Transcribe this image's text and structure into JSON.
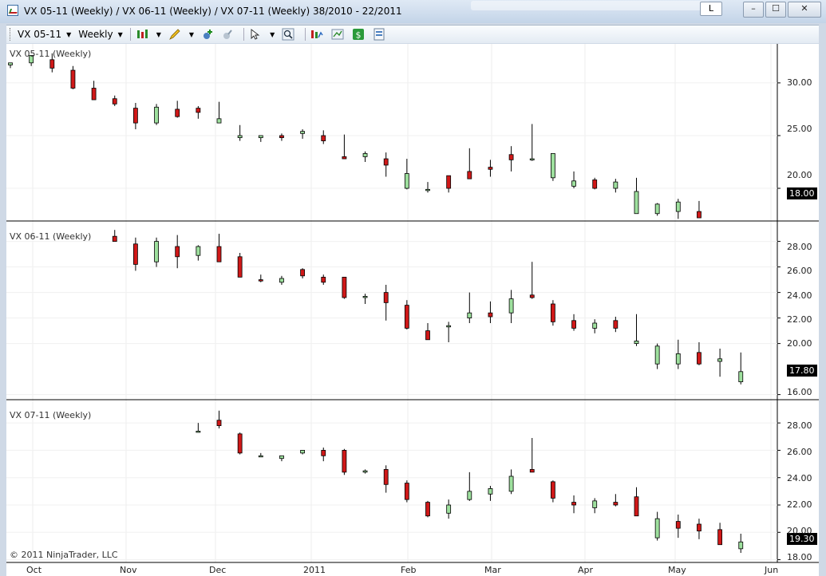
{
  "window": {
    "title": "VX 05-11 (Weekly) / VX 06-11 (Weekly) / VX 07-11 (Weekly)  38/2010 - 22/2011",
    "link_button": "L",
    "minimize": "–",
    "maximize": "☐",
    "close": "✕"
  },
  "toolbar": {
    "instrument": "VX 05-11",
    "interval": "Weekly"
  },
  "chart": {
    "copyright": "© 2011 NinjaTrader, LLC",
    "x_axis_labels": [
      "Oct",
      "Nov",
      "Dec",
      "2011",
      "Feb",
      "Mar",
      "Apr",
      "May",
      "Jun"
    ],
    "panels": [
      {
        "name": "VX 05-11 (Weekly)",
        "last_price": "18.00",
        "ticks": [
          "30.00",
          "25.00",
          "20.00"
        ]
      },
      {
        "name": "VX 06-11 (Weekly)",
        "last_price": "17.80",
        "ticks": [
          "28.00",
          "26.00",
          "24.00",
          "22.00",
          "20.00",
          "16.00"
        ]
      },
      {
        "name": "VX 07-11 (Weekly)",
        "last_price": "19.30",
        "ticks": [
          "28.00",
          "26.00",
          "24.00",
          "22.00",
          "20.00",
          "18.00"
        ]
      }
    ]
  },
  "colors": {
    "up": "#9ee09e",
    "down": "#d01818",
    "wick": "#000000",
    "background": "#ffffff"
  },
  "chart_data": {
    "type": "candlestick",
    "x": [
      "2010-09-27",
      "2010-10-04",
      "2010-10-11",
      "2010-10-18",
      "2010-10-25",
      "2010-11-01",
      "2010-11-08",
      "2010-11-15",
      "2010-11-22",
      "2010-11-29",
      "2010-12-06",
      "2010-12-13",
      "2010-12-20",
      "2010-12-27",
      "2011-01-03",
      "2011-01-10",
      "2011-01-17",
      "2011-01-24",
      "2011-01-31",
      "2011-02-07",
      "2011-02-14",
      "2011-02-21",
      "2011-02-28",
      "2011-03-07",
      "2011-03-14",
      "2011-03-21",
      "2011-03-28",
      "2011-04-04",
      "2011-04-11",
      "2011-04-18",
      "2011-04-25",
      "2011-05-02",
      "2011-05-09",
      "2011-05-16",
      "2011-05-23",
      "2011-05-30"
    ],
    "series": [
      {
        "name": "VX 05-11 (Weekly)",
        "open": [
          31.7,
          31.9,
          32.2,
          31.2,
          29.5,
          28.5,
          27.6,
          26.2,
          27.5,
          27.6,
          26.2,
          24.8,
          24.8,
          25.0,
          25.2,
          25.0,
          23.0,
          23.0,
          22.8,
          20.0,
          19.8,
          21.2,
          21.6,
          22.0,
          23.2,
          22.8,
          21.0,
          20.2,
          20.8,
          20.0,
          17.6,
          17.6,
          17.8,
          17.8,
          null,
          null
        ],
        "high": [
          31.9,
          32.6,
          32.8,
          31.6,
          30.2,
          28.8,
          28.1,
          28.0,
          28.3,
          27.8,
          28.2,
          26.0,
          25.0,
          25.2,
          25.6,
          25.5,
          25.1,
          23.5,
          23.4,
          22.8,
          20.6,
          21.2,
          23.8,
          22.7,
          24.0,
          26.1,
          23.0,
          21.6,
          21.0,
          20.9,
          21.0,
          18.6,
          19.0,
          18.8,
          19.2,
          null
        ],
        "low": [
          31.4,
          31.6,
          31.0,
          29.4,
          28.4,
          27.8,
          25.6,
          26.0,
          26.7,
          26.6,
          26.4,
          24.5,
          24.4,
          24.5,
          24.7,
          24.2,
          22.9,
          22.5,
          21.1,
          19.9,
          19.6,
          19.6,
          21.0,
          21.1,
          21.6,
          22.6,
          20.7,
          20.0,
          19.9,
          19.6,
          17.6,
          17.4,
          17.1,
          17.3,
          17.4,
          null
        ],
        "close": [
          31.9,
          32.6,
          31.4,
          29.5,
          28.4,
          28.0,
          26.2,
          27.7,
          26.8,
          27.2,
          26.6,
          25.0,
          25.0,
          24.8,
          25.4,
          24.5,
          22.8,
          23.3,
          22.2,
          21.4,
          19.9,
          20.0,
          20.9,
          21.8,
          22.7,
          22.8,
          23.3,
          20.7,
          20.0,
          20.6,
          19.7,
          18.5,
          18.7,
          17.2,
          18.0,
          null
        ]
      },
      {
        "name": "VX 06-11 (Weekly)",
        "open": [
          null,
          null,
          null,
          null,
          null,
          28.4,
          27.8,
          26.4,
          27.6,
          26.9,
          27.6,
          26.8,
          25.0,
          24.8,
          25.8,
          25.2,
          25.2,
          23.6,
          24.0,
          23.0,
          21.0,
          21.3,
          22.0,
          22.4,
          22.4,
          23.8,
          23.1,
          21.8,
          21.2,
          21.8,
          20.0,
          18.4,
          18.4,
          19.3,
          18.6,
          17.0
        ],
        "high": [
          null,
          null,
          null,
          null,
          null,
          28.9,
          28.3,
          28.3,
          28.5,
          27.7,
          28.6,
          27.1,
          25.4,
          25.3,
          25.9,
          25.4,
          25.2,
          23.9,
          24.6,
          23.4,
          21.6,
          21.7,
          24.0,
          23.3,
          24.2,
          26.4,
          23.4,
          22.3,
          21.9,
          22.1,
          22.3,
          20.0,
          20.3,
          20.1,
          19.6,
          19.3
        ],
        "low": [
          null,
          null,
          null,
          null,
          null,
          28.0,
          25.7,
          26.0,
          25.9,
          26.5,
          26.4,
          25.2,
          24.8,
          24.6,
          25.1,
          24.6,
          23.5,
          23.1,
          21.8,
          21.1,
          20.3,
          20.1,
          21.6,
          21.6,
          21.6,
          23.5,
          21.4,
          21.0,
          20.8,
          20.9,
          19.8,
          18.0,
          18.0,
          18.3,
          17.4,
          16.8
        ],
        "close": [
          null,
          null,
          null,
          null,
          null,
          28.0,
          26.2,
          28.0,
          26.8,
          27.6,
          26.4,
          25.2,
          24.9,
          25.1,
          25.3,
          24.8,
          23.6,
          23.7,
          23.2,
          21.2,
          20.3,
          21.4,
          22.4,
          22.1,
          23.5,
          23.6,
          21.7,
          21.2,
          21.6,
          21.2,
          20.2,
          19.8,
          19.2,
          18.4,
          18.8,
          17.8
        ]
      },
      {
        "name": "VX 07-11 (Weekly)",
        "open": [
          null,
          null,
          null,
          null,
          null,
          null,
          null,
          null,
          null,
          27.4,
          28.2,
          27.2,
          25.6,
          25.4,
          25.8,
          26.0,
          26.0,
          24.4,
          24.6,
          23.6,
          22.2,
          21.4,
          22.4,
          22.8,
          23.0,
          24.6,
          23.7,
          22.2,
          21.8,
          22.2,
          22.6,
          19.6,
          20.8,
          20.6,
          20.2,
          18.8
        ],
        "high": [
          null,
          null,
          null,
          null,
          null,
          null,
          null,
          null,
          null,
          28.0,
          28.9,
          27.3,
          25.8,
          25.6,
          26.0,
          26.2,
          26.1,
          24.6,
          24.9,
          23.8,
          22.3,
          22.4,
          24.4,
          23.4,
          24.6,
          26.9,
          23.8,
          22.7,
          22.5,
          22.8,
          23.3,
          21.5,
          21.3,
          21.0,
          20.7,
          19.9
        ],
        "low": [
          null,
          null,
          null,
          null,
          null,
          null,
          null,
          null,
          null,
          27.3,
          27.6,
          25.7,
          25.5,
          25.2,
          25.7,
          25.2,
          24.2,
          24.3,
          22.9,
          22.2,
          21.1,
          21.0,
          22.3,
          22.3,
          22.8,
          24.5,
          22.2,
          21.4,
          21.4,
          21.9,
          21.6,
          19.4,
          19.6,
          19.5,
          19.3,
          18.5
        ],
        "close": [
          null,
          null,
          null,
          null,
          null,
          null,
          null,
          null,
          null,
          27.4,
          27.8,
          25.8,
          25.6,
          25.6,
          26.0,
          25.6,
          24.4,
          24.5,
          23.5,
          22.4,
          21.2,
          22.0,
          23.0,
          23.2,
          24.1,
          24.4,
          22.5,
          22.0,
          22.3,
          22.0,
          21.2,
          21.0,
          20.3,
          20.1,
          19.1,
          19.3
        ]
      }
    ],
    "ylims": [
      [
        16.9,
        33.7
      ],
      [
        15.6,
        29.6
      ],
      [
        17.8,
        29.7
      ]
    ],
    "xlabel": "",
    "ylabel": "",
    "grid": true,
    "legend": "none"
  }
}
